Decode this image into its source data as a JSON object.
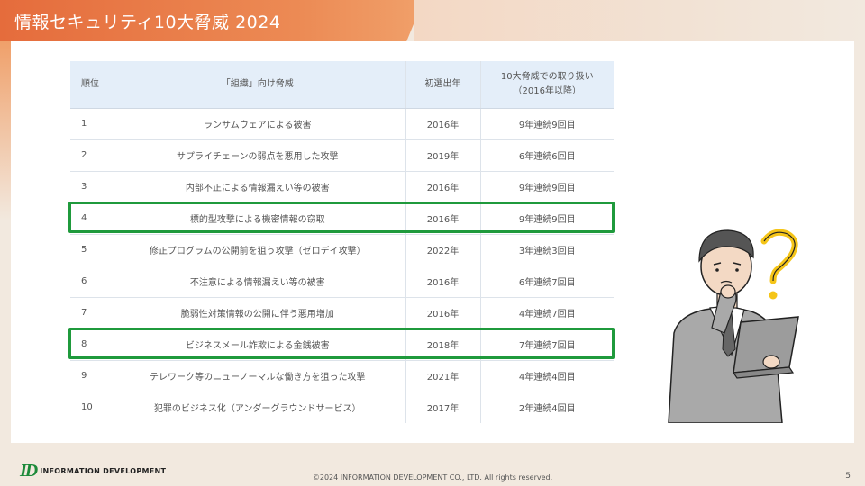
{
  "header": {
    "title": "情報セキュリティ10大脅威 2024"
  },
  "table": {
    "headers": {
      "rank": "順位",
      "name": "「組織」向け脅威",
      "first": "初選出年",
      "history_line1": "10大脅威での取り扱い",
      "history_line2": "（2016年以降）"
    },
    "rows": [
      {
        "rank": "1",
        "name": "ランサムウェアによる被害",
        "first": "2016年",
        "history": "9年連続9回目"
      },
      {
        "rank": "2",
        "name": "サプライチェーンの弱点を悪用した攻撃",
        "first": "2019年",
        "history": "6年連続6回目"
      },
      {
        "rank": "3",
        "name": "内部不正による情報漏えい等の被害",
        "first": "2016年",
        "history": "9年連続9回目"
      },
      {
        "rank": "4",
        "name": "標的型攻撃による機密情報の窃取",
        "first": "2016年",
        "history": "9年連続9回目"
      },
      {
        "rank": "5",
        "name": "修正プログラムの公開前を狙う攻撃（ゼロデイ攻撃）",
        "first": "2022年",
        "history": "3年連続3回目"
      },
      {
        "rank": "6",
        "name": "不注意による情報漏えい等の被害",
        "first": "2016年",
        "history": "6年連続7回目"
      },
      {
        "rank": "7",
        "name": "脆弱性対策情報の公開に伴う悪用増加",
        "first": "2016年",
        "history": "4年連続7回目"
      },
      {
        "rank": "8",
        "name": "ビジネスメール詐欺による金銭被害",
        "first": "2018年",
        "history": "7年連続7回目"
      },
      {
        "rank": "9",
        "name": "テレワーク等のニューノーマルな働き方を狙った攻撃",
        "first": "2021年",
        "history": "4年連続4回目"
      },
      {
        "rank": "10",
        "name": "犯罪のビジネス化（アンダーグラウンドサービス）",
        "first": "2017年",
        "history": "2年連続4回目"
      }
    ],
    "highlighted_ranks": [
      "4",
      "8"
    ]
  },
  "footer": {
    "logo_mark": "ID",
    "logo_text": "INFORMATION DEVELOPMENT",
    "copyright": "©2024 INFORMATION DEVELOPMENT CO., LTD. All rights reserved.",
    "page_number": "5"
  },
  "colors": {
    "accent": "#e56c3c",
    "highlight": "#1f9a3c",
    "header_cell": "#e4eef9"
  },
  "illustration": {
    "icon": "confused-person-with-laptop-icon"
  }
}
